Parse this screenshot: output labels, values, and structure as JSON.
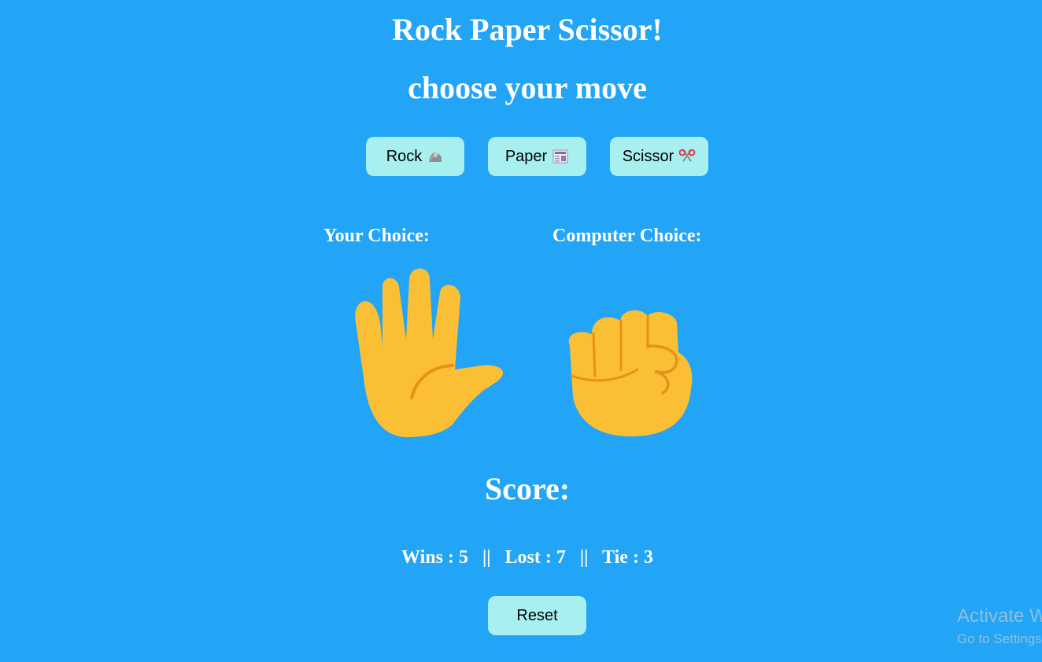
{
  "header": {
    "title": "Rock Paper Scissor!",
    "subtitle": "choose your move"
  },
  "moves": {
    "rock_label": "Rock",
    "paper_label": "Paper",
    "scissor_label": "Scissor"
  },
  "choices": {
    "your_label": "Your Choice:",
    "computer_label": "Computer Choice:",
    "your_choice": "paper",
    "computer_choice": "rock"
  },
  "score": {
    "heading": "Score:",
    "wins_label": "Wins",
    "wins": 5,
    "lost_label": "Lost",
    "lost": 7,
    "tie_label": "Tie",
    "tie": 3,
    "separator": "||"
  },
  "controls": {
    "reset_label": "Reset"
  },
  "watermark": {
    "title": "Activate W",
    "subtitle": "Go to Settings"
  },
  "colors": {
    "background": "#22a4f7",
    "button": "#a8f0ef",
    "hand": "#fbbf35",
    "hand_line": "#e8901a"
  }
}
